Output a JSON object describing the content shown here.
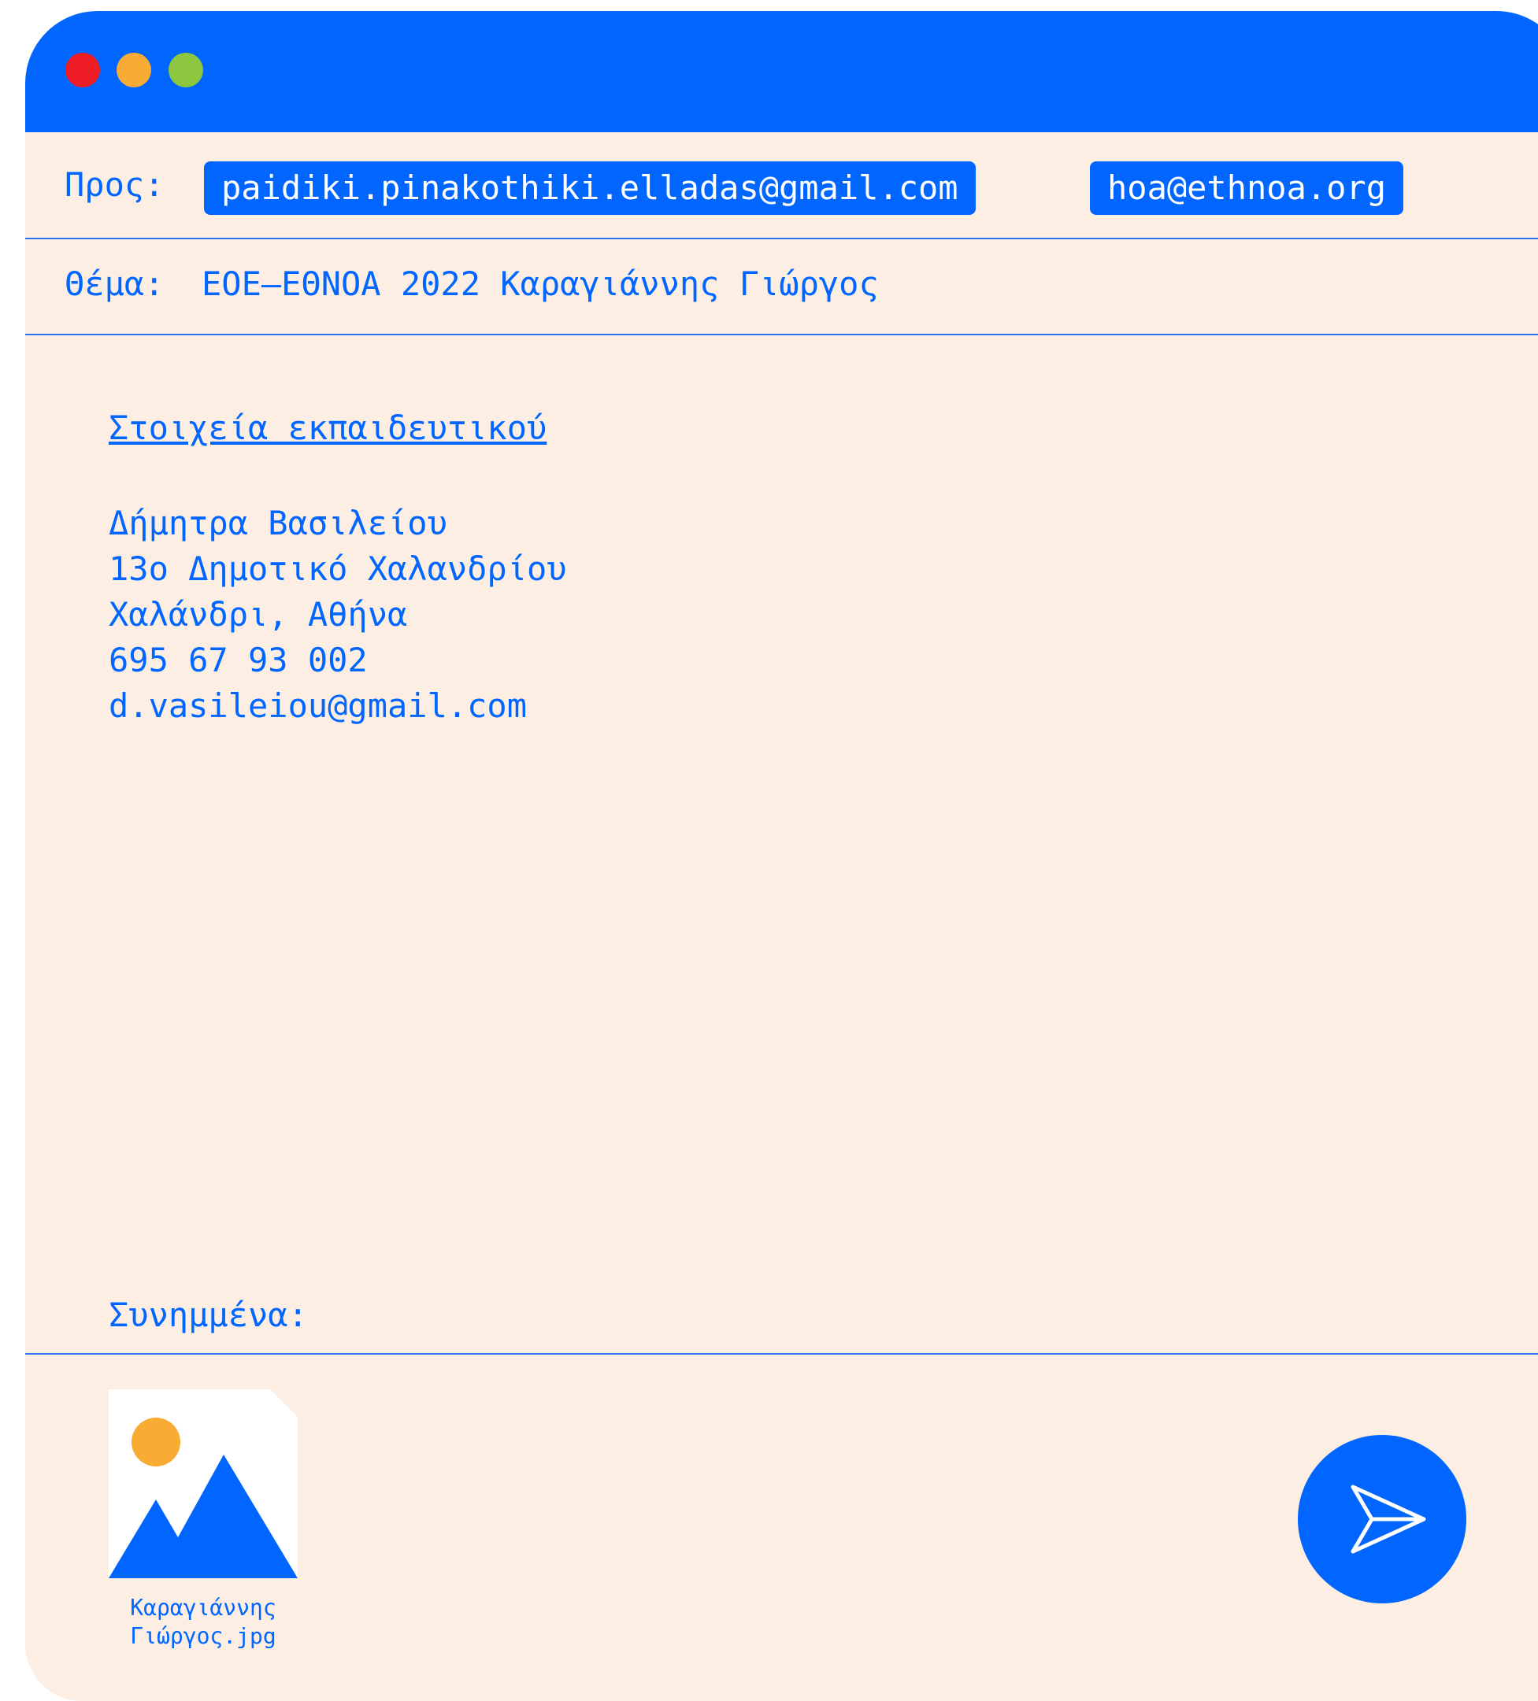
{
  "window": {
    "controls": [
      "close-dot",
      "minimize-dot",
      "maximize-dot"
    ],
    "colors": {
      "titlebar": "#0066ff",
      "background": "#fdeee3",
      "close": "#ee1c25",
      "minimize": "#f9ac33",
      "maximize": "#8dc63f"
    }
  },
  "to": {
    "label": "Προς:",
    "recipients": [
      "paidiki.pinakothiki.elladas@gmail.com",
      "hoa@ethnoa.org"
    ]
  },
  "subject": {
    "label": "Θέμα:",
    "value": "ΕΟΕ–ΕΘΝΟΑ 2022 Καραγιάννης Γιώργος"
  },
  "body": {
    "section_title": "Στοιχεία εκπαιδευτικού",
    "lines": [
      "Δήμητρα Βασιλείου",
      "13ο Δημοτικό Χαλανδρίου",
      "Χαλάνδρι, Αθήνα",
      "695 67 93 002",
      "d.vasileiou@gmail.com"
    ]
  },
  "attachments": {
    "label": "Συνημμένα:",
    "files": [
      {
        "name_line1": "Καραγιάννης",
        "name_line2": "Γιώργος.jpg",
        "icon": "image-file-icon"
      }
    ]
  },
  "send": {
    "icon": "send-icon"
  }
}
